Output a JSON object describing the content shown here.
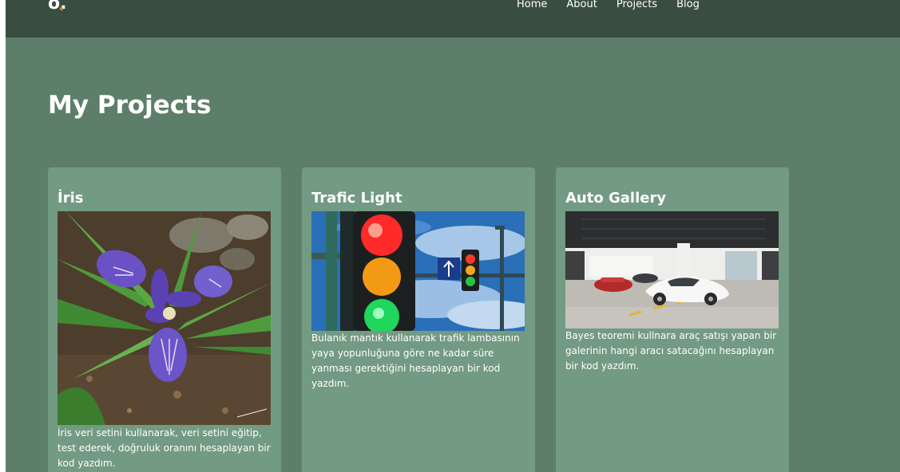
{
  "logo": "o.",
  "nav": {
    "links": [
      "Home",
      "About",
      "Projects",
      "Blog"
    ]
  },
  "page_title": "My Projects",
  "projects": [
    {
      "title": "İris",
      "description": "İris veri setini kullanarak, veri setini eğitip, test ederek, doğruluk oranını hesaplayan bir kod yazdım."
    },
    {
      "title": "Trafic Light",
      "description": "Bulanık mantık kullanarak trafik lambasının yaya yopunluğuna göre ne kadar süre yanması gerektiğini hesaplayan bir kod yazdım."
    },
    {
      "title": "Auto Gallery",
      "description": "Bayes teoremi kullnara araç satışı yapan bir galerinin hangi aracı satacağını hesaplayan bir kod yazdım."
    }
  ],
  "colors": {
    "navbar": "#3a4d41",
    "background": "#5d7f6a",
    "card": "#739a83",
    "logo_accent": "#c8902f"
  }
}
